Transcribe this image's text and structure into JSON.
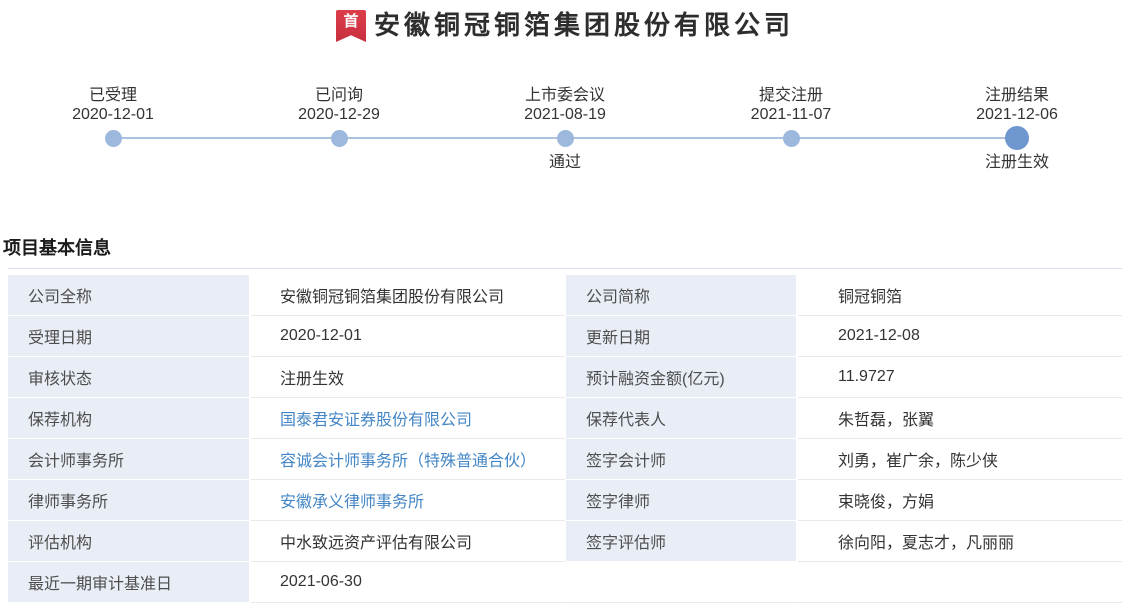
{
  "colors": {
    "badge-red": "#dd3d4b",
    "badge-red-dark": "#c72f3d",
    "link-blue": "#4486c6",
    "dot-blue": "#9cb8dc",
    "dot-active-blue": "#6e96cf",
    "line-blue": "#aac2e0",
    "label-cell-bg": "#e9eef6"
  },
  "header": {
    "badge": "首",
    "title": "安徽铜冠铜箔集团股份有限公司"
  },
  "timeline": {
    "stages": [
      {
        "label": "已受理",
        "date": "2020-12-01",
        "sub": ""
      },
      {
        "label": "已问询",
        "date": "2020-12-29",
        "sub": ""
      },
      {
        "label": "上市委会议",
        "date": "2021-08-19",
        "sub": "通过"
      },
      {
        "label": "提交注册",
        "date": "2021-11-07",
        "sub": ""
      },
      {
        "label": "注册结果",
        "date": "2021-12-06",
        "sub": "注册生效"
      }
    ]
  },
  "section": {
    "title": "项目基本信息"
  },
  "table": {
    "rows": [
      {
        "label1": "公司全称",
        "value1": "安徽铜冠铜箔集团股份有限公司",
        "label2": "公司简称",
        "value2": "铜冠铜箔"
      },
      {
        "label1": "受理日期",
        "value1": "2020-12-01",
        "label2": "更新日期",
        "value2": "2021-12-08"
      },
      {
        "label1": "审核状态",
        "value1": "注册生效",
        "label2": "预计融资金额(亿元)",
        "value2": "11.9727"
      },
      {
        "label1": "保荐机构",
        "value1": "国泰君安证券股份有限公司",
        "label2": "保荐代表人",
        "value2": "朱哲磊，张翼"
      },
      {
        "label1": "会计师事务所",
        "value1": "容诚会计师事务所（特殊普通合伙）",
        "label2": "签字会计师",
        "value2": "刘勇，崔广余，陈少侠"
      },
      {
        "label1": "律师事务所",
        "value1": "安徽承义律师事务所",
        "label2": "签字律师",
        "value2": "束晓俊，方娟"
      },
      {
        "label1": "评估机构",
        "value1": "中水致远资产评估有限公司",
        "label2": "签字评估师",
        "value2": "徐向阳，夏志才，凡丽丽"
      },
      {
        "label1": "最近一期审计基准日",
        "value1": "2021-06-30",
        "label2": "",
        "value2": ""
      }
    ]
  }
}
